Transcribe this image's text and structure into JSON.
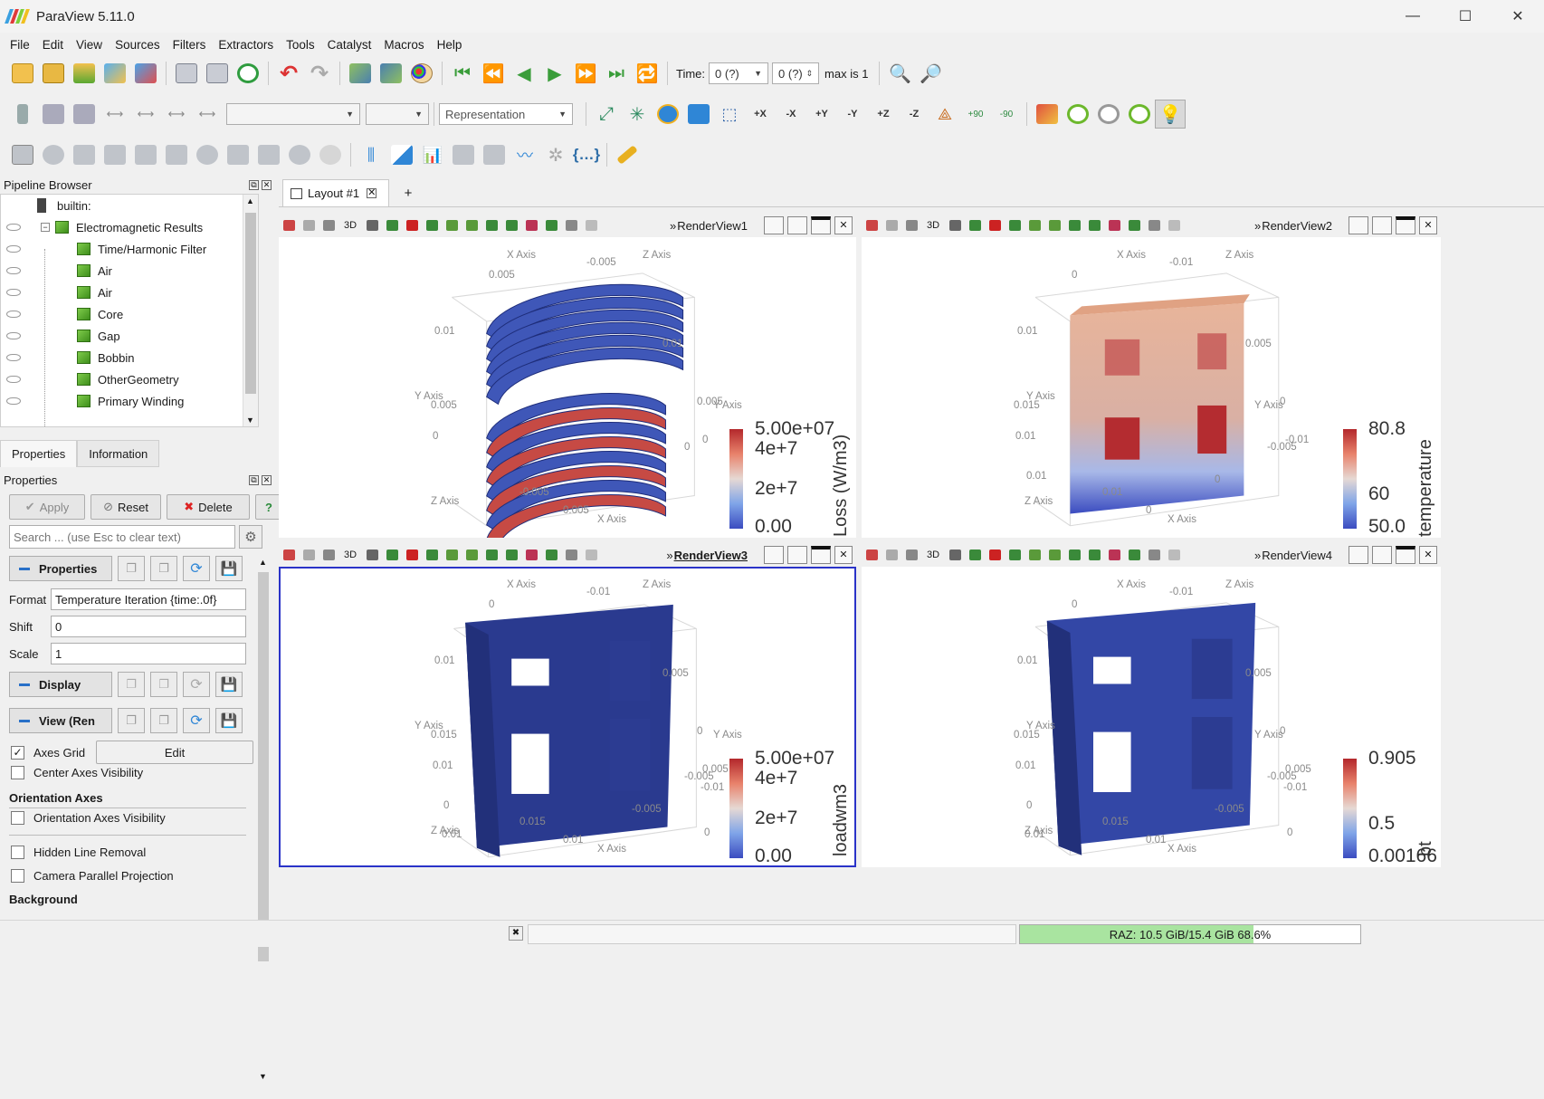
{
  "window": {
    "title": "ParaView 5.11.0",
    "minimize": "—",
    "maximize": "☐",
    "close": "✕"
  },
  "menu": [
    "File",
    "Edit",
    "View",
    "Sources",
    "Filters",
    "Extractors",
    "Tools",
    "Catalyst",
    "Macros",
    "Help"
  ],
  "toolbar1": {
    "time_label": "Time:",
    "time_value": "0 (?)",
    "time_index": "0 (?)",
    "max_label": "max is 1"
  },
  "toolbar2": {
    "representation": "Representation",
    "rot_plus": "+90",
    "rot_minus": "-90",
    "axis_buttons": [
      "+X",
      "-X",
      "+Y",
      "-Y",
      "+Z",
      "-Z"
    ]
  },
  "pipeline": {
    "title": "Pipeline Browser",
    "root": "builtin:",
    "items": [
      {
        "label": "Electromagnetic Results",
        "level": 1
      },
      {
        "label": "Time/Harmonic Filter",
        "level": 2
      },
      {
        "label": "Air",
        "level": 2
      },
      {
        "label": "Air",
        "level": 2
      },
      {
        "label": "Core",
        "level": 2
      },
      {
        "label": "Gap",
        "level": 2
      },
      {
        "label": "Bobbin",
        "level": 2
      },
      {
        "label": "OtherGeometry",
        "level": 2
      },
      {
        "label": "Primary Winding",
        "level": 2
      }
    ]
  },
  "tabs": {
    "properties": "Properties",
    "information": "Information"
  },
  "properties": {
    "title": "Properties",
    "apply": "Apply",
    "reset": "Reset",
    "delete": "Delete",
    "help": "?",
    "search_placeholder": "Search ... (use Esc to clear text)",
    "section_properties": "Properties",
    "format_label": "Format",
    "format_value": "Temperature Iteration {time:.0f}",
    "shift_label": "Shift",
    "shift_value": "0",
    "scale_label": "Scale",
    "scale_value": "1",
    "section_display": "Display",
    "section_view": "View (Ren",
    "axes_grid": "Axes Grid",
    "edit": "Edit",
    "center_axes": "Center Axes Visibility",
    "orientation_header": "Orientation Axes",
    "orientation_vis": "Orientation Axes Visibility",
    "hidden_line": "Hidden Line Removal",
    "camera_parallel": "Camera Parallel Projection",
    "background_header": "Background"
  },
  "layout": {
    "tab": "Layout #1",
    "add": "+"
  },
  "views": [
    {
      "name": "RenderView1",
      "active": false,
      "legend_title": "Loss (W/m3)",
      "legend": [
        "5.00e+07",
        "4e+7",
        "2e+7",
        "0.00"
      ],
      "colormap": [
        "#b3282c",
        "#e8826b",
        "#e6d9d4",
        "#7fa4e8",
        "#3b4cc0"
      ]
    },
    {
      "name": "RenderView2",
      "active": false,
      "legend_title": "temperature",
      "legend": [
        "80.8",
        "60",
        "50.0"
      ],
      "colormap": [
        "#b3282c",
        "#e8826b",
        "#e6d9d4",
        "#7fa4e8",
        "#3b4cc0"
      ]
    },
    {
      "name": "RenderView3",
      "active": true,
      "legend_title": "loadwm3",
      "legend": [
        "5.00e+07",
        "4e+7",
        "2e+7",
        "0.00"
      ],
      "colormap": [
        "#b3282c",
        "#e8826b",
        "#e6d9d4",
        "#7fa4e8",
        "#3b4cc0"
      ]
    },
    {
      "name": "RenderView4",
      "active": false,
      "legend_title": "bt",
      "legend": [
        "0.905",
        "0.5",
        "0.00166"
      ],
      "colormap": [
        "#b3282c",
        "#e8826b",
        "#e6d9d4",
        "#7fa4e8",
        "#3b4cc0"
      ]
    }
  ],
  "axes": {
    "x": "X Axis",
    "y": "Y Axis",
    "z": "Z Axis",
    "ticks_v1": [
      "0.005",
      "-0.005",
      "0.01",
      "0.005",
      "0",
      "0.01",
      "0.005",
      "0",
      "-0.005",
      "0.005",
      "0"
    ],
    "ticks_v2": [
      "0",
      "-0.01",
      "0.01",
      "0.015",
      "0.01",
      "0.005",
      "0",
      "-0.005",
      "0.01",
      "0",
      "-0.01",
      "0.01",
      "0"
    ],
    "ticks_v3": [
      "0",
      "-0.01",
      "0.01",
      "0.015",
      "0.01",
      "0.005",
      "0",
      "-0.005",
      "0.015",
      "0.01",
      "0.005",
      "0",
      "-0.005",
      "-0.01",
      "0.01",
      "0"
    ],
    "ticks_v4": [
      "0",
      "-0.01",
      "0.01",
      "0.015",
      "0.01",
      "0.005",
      "0",
      "-0.005",
      "0.015",
      "0.01",
      "0.005",
      "0",
      "-0.005",
      "-0.01",
      "0.01",
      "0"
    ]
  },
  "status": {
    "memory": "RAZ: 10.5 GiB/15.4 GiB 68.6%",
    "memory_fraction": 0.686
  },
  "colors": {
    "accent": "#2a33c8",
    "copper": "#e0a283",
    "dark_blue": "#2a3a8f",
    "mid_blue": "#3f57b8",
    "memory_green": "#a9e4a0"
  }
}
